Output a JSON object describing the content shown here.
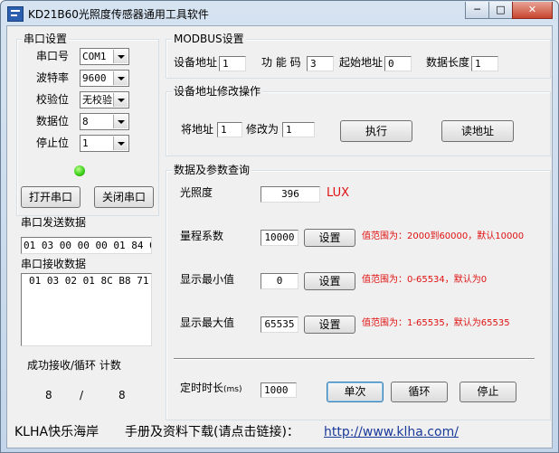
{
  "window": {
    "title": "KD21B60光照度传感器通用工具软件",
    "minimize_symbol": "─",
    "maximize_symbol": "□",
    "close_symbol": "✕"
  },
  "serial": {
    "group_title": "串口设置",
    "port_label": "串口号",
    "port_value": "COM1",
    "baud_label": "波特率",
    "baud_value": "9600",
    "parity_label": "校验位",
    "parity_value": "无校验",
    "databits_label": "数据位",
    "databits_value": "8",
    "stopbits_label": "停止位",
    "stopbits_value": "1",
    "status_led_color": "#3fd11c",
    "open_button": "打开串口",
    "close_button": "关闭串口",
    "send_label": "串口发送数据",
    "send_data": "01 03 00 00 00 01 84 0A",
    "recv_label": "串口接收数据",
    "recv_data": "01 03 02 01 8C B8 71",
    "counter_label": "成功接收/循环 计数",
    "success_count": "8",
    "separator": "/",
    "loop_count": "8"
  },
  "modbus": {
    "group_title": "MODBUS设置",
    "device_addr_label": "设备地址",
    "device_addr_value": "1",
    "function_code_label": "功 能 码",
    "function_code_value": "3",
    "start_addr_label": "起始地址",
    "start_addr_value": "0",
    "data_len_label": "数据长度",
    "data_len_value": "1"
  },
  "addr_modify": {
    "group_title": "设备地址修改操作",
    "from_label": "将地址",
    "from_value": "1",
    "to_label": "修改为",
    "to_value": "1",
    "execute_button": "执行",
    "read_button": "读地址"
  },
  "query": {
    "group_title": "数据及参数查询",
    "lux_label": "光照度",
    "lux_value": "396",
    "lux_unit": "LUX",
    "range_label": "量程系数",
    "range_value": "10000",
    "range_set": "设置",
    "range_hint": "值范围为：2000到60000，默认10000",
    "min_label": "显示最小值",
    "min_value": "0",
    "min_set": "设置",
    "min_hint": "值范围为：0-65534，默认为0",
    "max_label": "显示最大值",
    "max_value": "65535",
    "max_set": "设置",
    "max_hint": "值范围为：1-65535，默认为65535",
    "timer_label": "定时时长",
    "timer_unit": "(ms)",
    "timer_value": "1000",
    "single_button": "单次",
    "loop_button": "循环",
    "stop_button": "停止",
    "hint_color": "#e01010"
  },
  "footer": {
    "brand": "KLHA快乐海岸",
    "download_text": "手册及资料下载(请点击链接)：",
    "link_text": "http://www.klha.com/"
  }
}
